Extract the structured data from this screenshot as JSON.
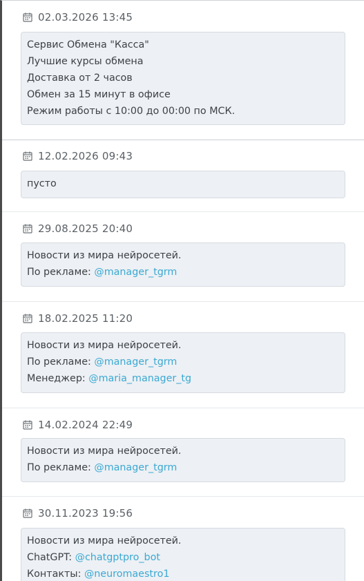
{
  "entries": [
    {
      "date": "02.03.2026 13:45",
      "lines": [
        {
          "text": "Сервис Обмена \"Касса\""
        },
        {
          "text": "Лучшие курсы обмена"
        },
        {
          "text": "Доставка от 2 часов"
        },
        {
          "text": "Обмен за 15 минут в офисе"
        },
        {
          "text": "Режим работы с 10:00 до 00:00 по МСК."
        }
      ]
    },
    {
      "date": "12.02.2026 09:43",
      "lines": [
        {
          "text": "пусто"
        }
      ]
    },
    {
      "date": "29.08.2025 20:40",
      "lines": [
        {
          "text": "Новости из мира нейросетей."
        },
        {
          "prefix": "По рекламе: ",
          "link": "@manager_tgrm"
        }
      ]
    },
    {
      "date": "18.02.2025 11:20",
      "lines": [
        {
          "text": "Новости из мира нейросетей."
        },
        {
          "prefix": "По рекламе: ",
          "link": "@manager_tgrm"
        },
        {
          "prefix": "Менеджер: ",
          "link": "@maria_manager_tg"
        }
      ]
    },
    {
      "date": "14.02.2024 22:49",
      "lines": [
        {
          "text": "Новости из мира нейросетей."
        },
        {
          "prefix": "По рекламе: ",
          "link": "@manager_tgrm"
        }
      ]
    },
    {
      "date": "30.11.2023 19:56",
      "lines": [
        {
          "text": "Новости из мира нейросетей."
        },
        {
          "prefix": "ChatGPT: ",
          "link": "@chatgptpro_bot"
        },
        {
          "prefix": "Контакты: ",
          "link": "@neuromaestro1"
        }
      ]
    }
  ],
  "icon": "calendar-icon",
  "colors": {
    "mention": "#3aa9d3",
    "box_background": "#edf0f4",
    "text": "#3d4247",
    "date_text": "#5b6166"
  }
}
